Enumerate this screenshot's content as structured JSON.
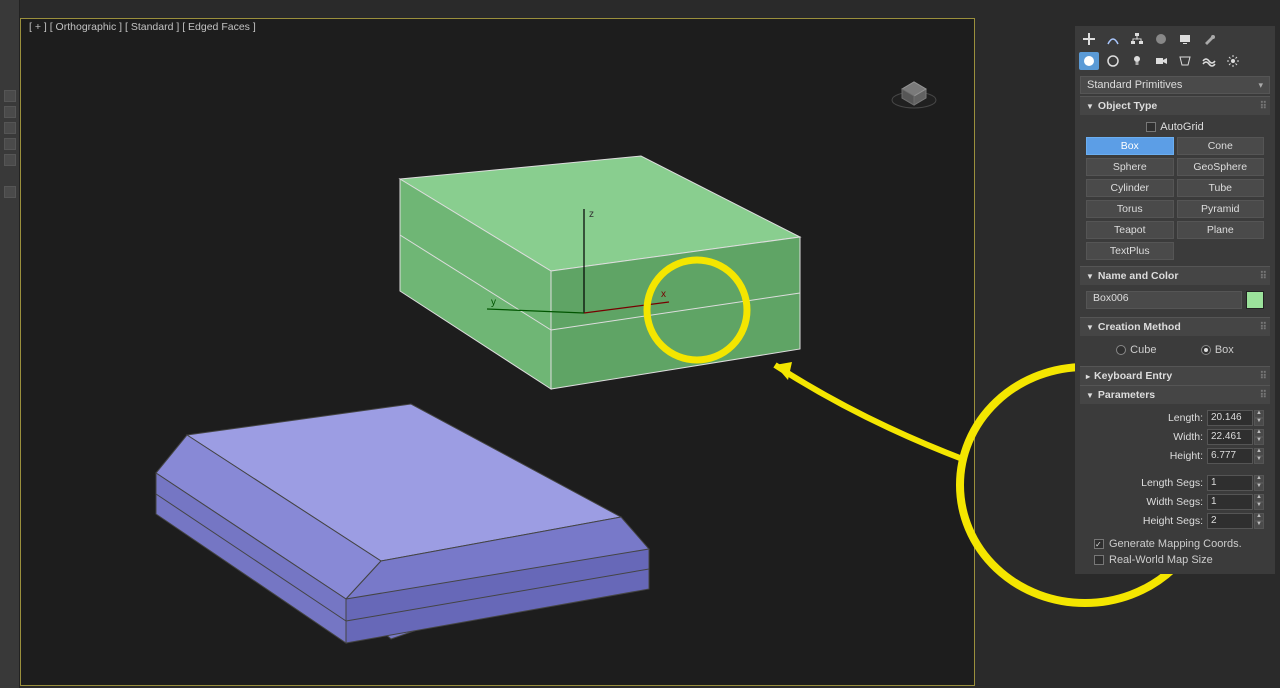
{
  "viewport": {
    "label": "[ + ] [ Orthographic ] [ Standard ] [ Edged Faces ]",
    "axes": {
      "x": "x",
      "y": "y",
      "z": "z"
    }
  },
  "panel": {
    "tool_icons_row1": [
      "plus",
      "curve",
      "snap",
      "sphere",
      "monitor",
      "wrench"
    ],
    "tool_icons_row2": [
      "circle",
      "ring",
      "bulb",
      "camera",
      "sound",
      "wave",
      "gear"
    ],
    "category_dropdown": "Standard Primitives",
    "rollouts": {
      "object_type": {
        "title": "Object Type",
        "autogrid": {
          "label": "AutoGrid",
          "checked": false
        },
        "buttons": [
          {
            "label": "Box",
            "selected": true
          },
          {
            "label": "Cone"
          },
          {
            "label": "Sphere"
          },
          {
            "label": "GeoSphere"
          },
          {
            "label": "Cylinder"
          },
          {
            "label": "Tube"
          },
          {
            "label": "Torus"
          },
          {
            "label": "Pyramid"
          },
          {
            "label": "Teapot"
          },
          {
            "label": "Plane"
          },
          {
            "label": "TextPlus"
          }
        ]
      },
      "name_color": {
        "title": "Name and Color",
        "name": "Box006",
        "color": "#9be29b"
      },
      "creation_method": {
        "title": "Creation Method",
        "options": [
          {
            "label": "Cube",
            "on": false
          },
          {
            "label": "Box",
            "on": true
          }
        ]
      },
      "keyboard_entry": {
        "title": "Keyboard Entry"
      },
      "parameters": {
        "title": "Parameters",
        "length": {
          "label": "Length:",
          "value": "20.146"
        },
        "width": {
          "label": "Width:",
          "value": "22.461"
        },
        "height": {
          "label": "Height:",
          "value": "6.777"
        },
        "length_segs": {
          "label": "Length Segs:",
          "value": "1"
        },
        "width_segs": {
          "label": "Width Segs:",
          "value": "1"
        },
        "height_segs": {
          "label": "Height Segs:",
          "value": "2"
        },
        "gen_mapping": {
          "label": "Generate Mapping Coords.",
          "checked": true
        },
        "real_world": {
          "label": "Real-World Map Size",
          "checked": false
        }
      }
    }
  }
}
